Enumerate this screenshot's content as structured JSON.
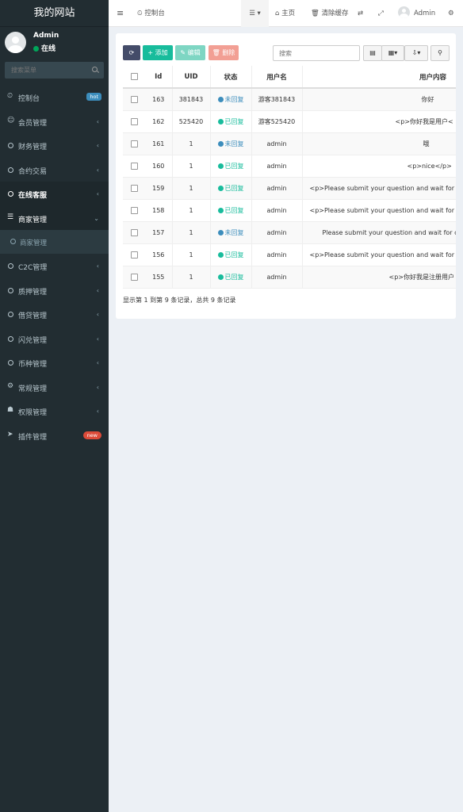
{
  "sidebar": {
    "logo": "我的网站",
    "user": {
      "name": "Admin",
      "status": "在线"
    },
    "search_placeholder": "搜索菜单",
    "items": [
      {
        "label": "控制台",
        "icon": "dashboard-icon",
        "badge": "hot"
      },
      {
        "label": "会员管理",
        "icon": "user-circle-icon"
      },
      {
        "label": "财务管理",
        "icon": "circle-icon"
      },
      {
        "label": "合约交易",
        "icon": "circle-icon"
      },
      {
        "label": "在线客服",
        "icon": "circle-icon"
      },
      {
        "label": "商家管理",
        "icon": "list-icon"
      },
      {
        "label": "C2C管理",
        "icon": "circle-icon"
      },
      {
        "label": "质押管理",
        "icon": "circle-icon"
      },
      {
        "label": "借贷管理",
        "icon": "circle-icon"
      },
      {
        "label": "闪兑管理",
        "icon": "circle-icon"
      },
      {
        "label": "币种管理",
        "icon": "circle-icon"
      },
      {
        "label": "常规管理",
        "icon": "cogs-icon"
      },
      {
        "label": "权限管理",
        "icon": "group-icon"
      },
      {
        "label": "插件管理",
        "icon": "rocket-icon",
        "badge": "new"
      }
    ],
    "subitem": "商家管理"
  },
  "topbar": {
    "dashboard": "控制台",
    "home": "主页",
    "clear_cache": "清除缓存",
    "admin": "Admin"
  },
  "toolbar": {
    "add": "添加",
    "edit": "编辑",
    "delete": "删除",
    "search_placeholder": "搜索"
  },
  "table": {
    "headers": [
      "Id",
      "UID",
      "状态",
      "用户名",
      "用户内容"
    ],
    "rows": [
      {
        "id": "163",
        "uid": "381843",
        "status": "未回复",
        "username": "游客381843",
        "content": "你好"
      },
      {
        "id": "162",
        "uid": "525420",
        "status": "已回复",
        "username": "游客525420",
        "content": "<p>你好我是用户<"
      },
      {
        "id": "161",
        "uid": "1",
        "status": "未回复",
        "username": "admin",
        "content": "哦"
      },
      {
        "id": "160",
        "uid": "1",
        "status": "已回复",
        "username": "admin",
        "content": "<p>nice</p>"
      },
      {
        "id": "159",
        "uid": "1",
        "status": "已回复",
        "username": "admin",
        "content": "<p>Please submit your question and wait for c"
      },
      {
        "id": "158",
        "uid": "1",
        "status": "已回复",
        "username": "admin",
        "content": "<p>Please submit your question and wait for c"
      },
      {
        "id": "157",
        "uid": "1",
        "status": "未回复",
        "username": "admin",
        "content": "Please submit your question and wait for c"
      },
      {
        "id": "156",
        "uid": "1",
        "status": "已回复",
        "username": "admin",
        "content": "<p>Please submit your question and wait for c"
      },
      {
        "id": "155",
        "uid": "1",
        "status": "已回复",
        "username": "admin",
        "content": "<p>你好我是注册用户"
      }
    ],
    "footer": "显示第 1 到第 9 条记录，总共 9 条记录"
  },
  "colors": {
    "replied": "#18bc9c",
    "unreplied": "#3c8dbc"
  }
}
